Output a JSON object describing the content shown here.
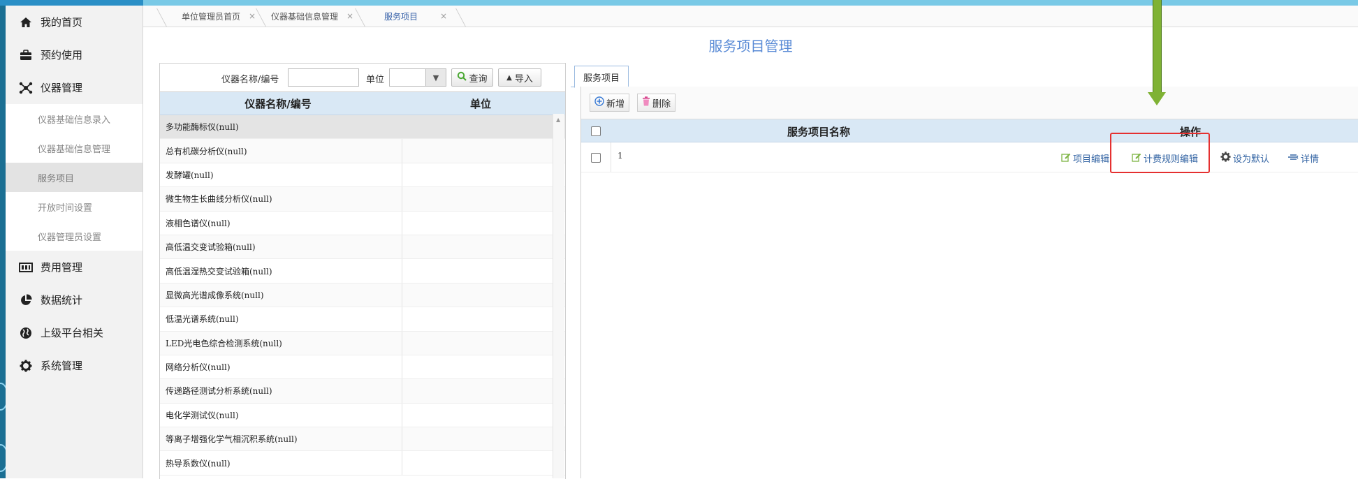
{
  "sidebar": {
    "items": [
      {
        "label": "我的首页",
        "icon": "home-icon"
      },
      {
        "label": "预约使用",
        "icon": "briefcase-icon"
      },
      {
        "label": "仪器管理",
        "icon": "gear-network-icon"
      }
    ],
    "sub_items": [
      {
        "label": "仪器基础信息录入"
      },
      {
        "label": "仪器基础信息管理"
      },
      {
        "label": "服务项目"
      },
      {
        "label": "开放时间设置"
      },
      {
        "label": "仪器管理员设置"
      }
    ],
    "items_after": [
      {
        "label": "费用管理",
        "icon": "billing-icon"
      },
      {
        "label": "数据统计",
        "icon": "pie-chart-icon"
      },
      {
        "label": "上级平台相关",
        "icon": "globe-icon"
      },
      {
        "label": "系统管理",
        "icon": "settings-icon"
      }
    ]
  },
  "tabs": [
    {
      "label": "单位管理员首页",
      "close": "×"
    },
    {
      "label": "仪器基础信息管理",
      "close": "×"
    },
    {
      "label": "服务项目",
      "close": "×"
    }
  ],
  "page_title": "服务项目管理",
  "search": {
    "name_label": "仪器名称/编号",
    "name_value": "",
    "unit_label": "单位",
    "unit_value": "",
    "query_button": "查询",
    "import_button": "导入"
  },
  "instrument_grid": {
    "columns": [
      "仪器名称/编号",
      "单位"
    ],
    "rows": [
      {
        "name": "多功能酶标仪(null)",
        "unit": ""
      },
      {
        "name": "总有机碳分析仪(null)",
        "unit": ""
      },
      {
        "name": "发酵罐(null)",
        "unit": ""
      },
      {
        "name": "微生物生长曲线分析仪(null)",
        "unit": ""
      },
      {
        "name": "液相色谱仪(null)",
        "unit": ""
      },
      {
        "name": "高低温交变试验箱(null)",
        "unit": ""
      },
      {
        "name": "高低温湿热交变试验箱(null)",
        "unit": ""
      },
      {
        "name": "显微高光谱成像系统(null)",
        "unit": ""
      },
      {
        "name": "低温光谱系统(null)",
        "unit": ""
      },
      {
        "name": "LED光电色综合检测系统(null)",
        "unit": ""
      },
      {
        "name": "网络分析仪(null)",
        "unit": ""
      },
      {
        "name": "传递路径测试分析系统(null)",
        "unit": ""
      },
      {
        "name": "电化学测试仪(null)",
        "unit": ""
      },
      {
        "name": "等离子增强化学气相沉积系统(null)",
        "unit": ""
      },
      {
        "name": "热导系数仪(null)",
        "unit": ""
      }
    ]
  },
  "service_panel": {
    "tab_label": "服务项目",
    "add_button": "新增",
    "delete_button": "删除",
    "columns": {
      "name": "服务项目名称",
      "ops": "操作"
    },
    "rows": [
      {
        "name": "1",
        "ops": {
          "edit_item": "项目编辑",
          "edit_billing": "计费规则编辑",
          "set_default": "设为默认",
          "detail": "详情"
        }
      }
    ]
  },
  "colors": {
    "title": "#5a8bd6",
    "link": "#3465a4",
    "highlight_box": "#e53030",
    "arrow": "#7fb234",
    "grid_header": "#d9e8f5"
  }
}
